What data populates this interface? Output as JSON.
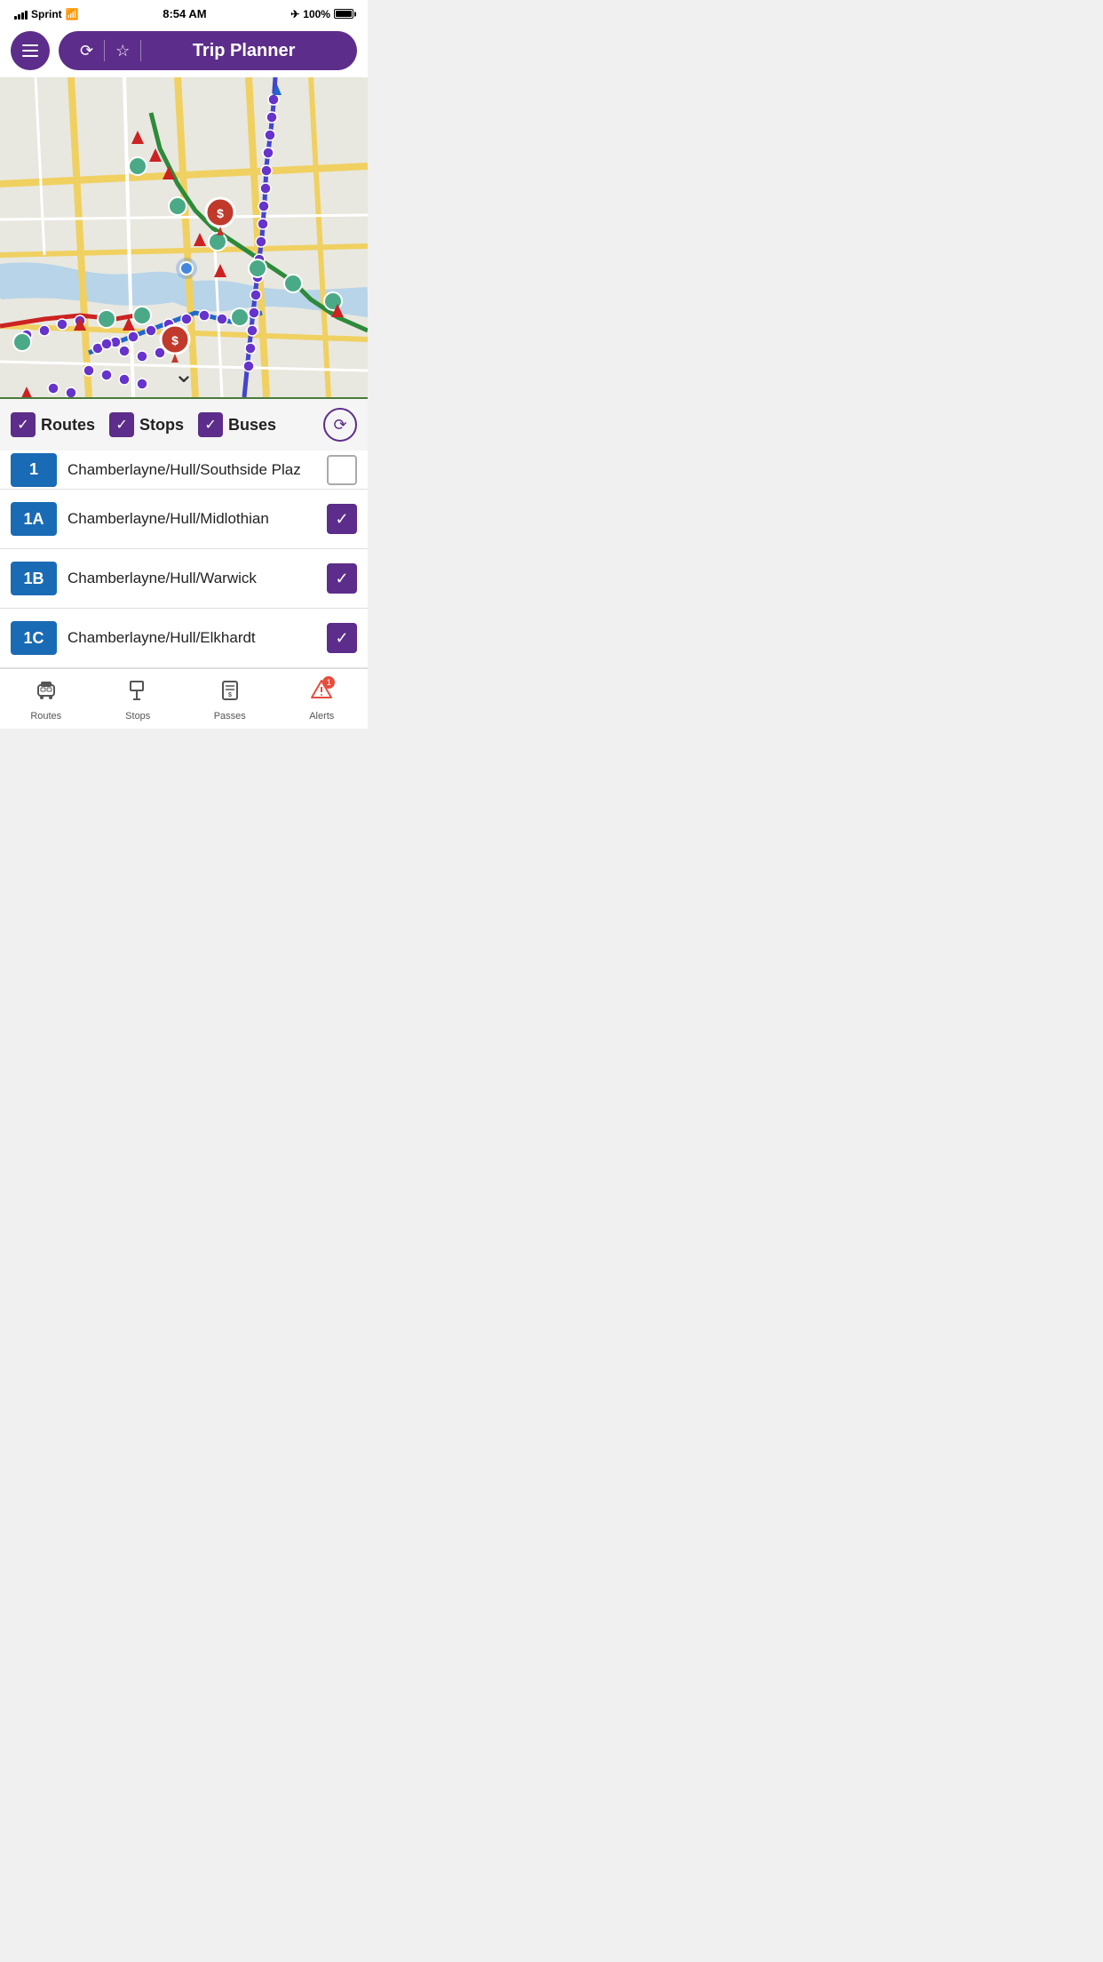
{
  "statusBar": {
    "carrier": "Sprint",
    "time": "8:54 AM",
    "battery": "100%"
  },
  "header": {
    "menuLabel": "☰",
    "historyIcon": "⟳",
    "favoriteIcon": "★",
    "title": "Trip Planner"
  },
  "filters": {
    "routes": {
      "label": "Routes",
      "checked": true
    },
    "stops": {
      "label": "Stops",
      "checked": true
    },
    "buses": {
      "label": "Buses",
      "checked": true
    },
    "historyBtn": "⟳"
  },
  "routes": [
    {
      "id": "1",
      "badge": "1",
      "name": "Chamberlayne/Hull/Southside Plaz",
      "checked": false
    },
    {
      "id": "1A",
      "badge": "1A",
      "name": "Chamberlayne/Hull/Midlothian",
      "checked": true
    },
    {
      "id": "1B",
      "badge": "1B",
      "name": "Chamberlayne/Hull/Warwick",
      "checked": true
    },
    {
      "id": "1C",
      "badge": "1C",
      "name": "Chamberlayne/Hull/Elkhardt",
      "checked": true
    }
  ],
  "bottomNav": [
    {
      "id": "routes",
      "icon": "🚌",
      "label": "Routes",
      "alert": false
    },
    {
      "id": "stops",
      "icon": "🚩",
      "label": "Stops",
      "alert": false
    },
    {
      "id": "passes",
      "icon": "🎫",
      "label": "Passes",
      "alert": false
    },
    {
      "id": "alerts",
      "icon": "⚠",
      "label": "Alerts",
      "alert": true,
      "count": "1"
    }
  ]
}
